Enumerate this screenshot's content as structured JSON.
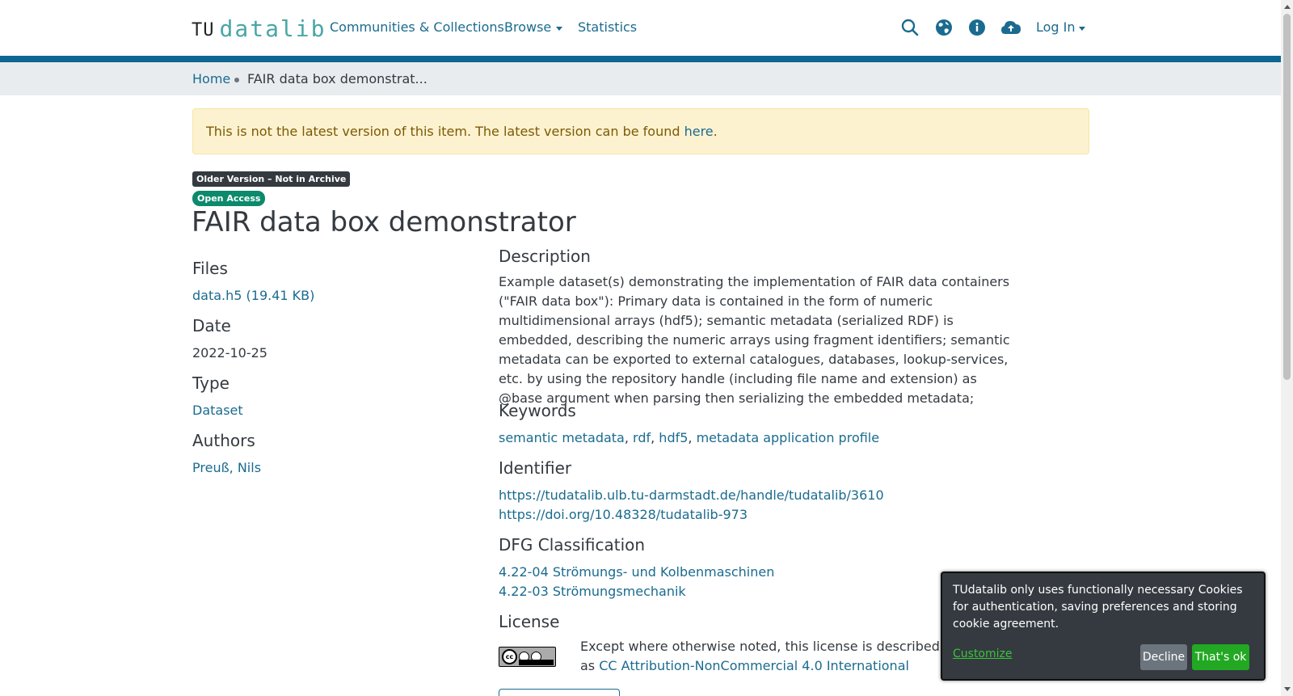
{
  "header": {
    "brand_tu": "TU",
    "brand_datalib": "datalib",
    "nav_communities": "Communities & Collections",
    "nav_browse": "Browse",
    "nav_statistics": "Statistics",
    "login": "Log In",
    "icons": [
      "search-icon",
      "globe-icon",
      "info-icon",
      "cloud-upload-icon"
    ]
  },
  "breadcrumb": {
    "home": "Home",
    "current": "FAIR data box demonstrat..."
  },
  "alert": {
    "text": "This is not the latest version of this item. The latest version can be found ",
    "link": "here",
    "suffix": "."
  },
  "badges": {
    "older": "Older Version – Not in Archive",
    "open": "Open Access"
  },
  "item": {
    "title": "FAIR data box demonstrator",
    "files_label": "Files",
    "file": "data.h5 (19.41 KB)",
    "date_label": "Date",
    "date": "2022-10-25",
    "type_label": "Type",
    "type": "Dataset",
    "authors_label": "Authors",
    "author": "Preuß, Nils",
    "description_label": "Description",
    "description": "Example dataset(s) demonstrating the implementation of FAIR data containers (\"FAIR data box\"): Primary data is contained in the form of numeric multidimensional arrays (hdf5); semantic metadata (serialized RDF) is embedded, describing the numeric arrays using fragment identifiers; semantic metadata can be exported to external catalogues, databases, lookup-services, etc. by using the repository handle (including file name and extension) as @base argument when parsing then serializing the embedded metadata;",
    "keywords_label": "Keywords",
    "keywords": [
      "semantic metadata",
      "rdf",
      "hdf5",
      "metadata application profile"
    ],
    "identifier_label": "Identifier",
    "identifiers": [
      "https://tudatalib.ulb.tu-darmstadt.de/handle/tudatalib/3610",
      "https://doi.org/10.48328/tudatalib-973"
    ],
    "dfg_label": "DFG Classification",
    "dfg": [
      "4.22-04 Strömungs- und Kolbenmaschinen",
      "4.22-03 Strömungsmechanik"
    ],
    "license_label": "License",
    "license_text": "Except where otherwise noted, this license is described as ",
    "license_link": "CC Attribution-NonCommercial 4.0 International",
    "cc_text": "cc",
    "cc_by": "BY",
    "cc_nc": "NC"
  },
  "cookie": {
    "text": "TUdatalib only uses functionally necessary Cookies for authentication, saving preferences and storing cookie agreement.",
    "customize": "Customize",
    "decline": "Decline",
    "ok": "That's ok"
  },
  "colors": {
    "primary": "#1a6b8f",
    "header_bar": "#0d6792",
    "alert_bg": "#fdf2cf",
    "ok_green": "#22a822"
  }
}
